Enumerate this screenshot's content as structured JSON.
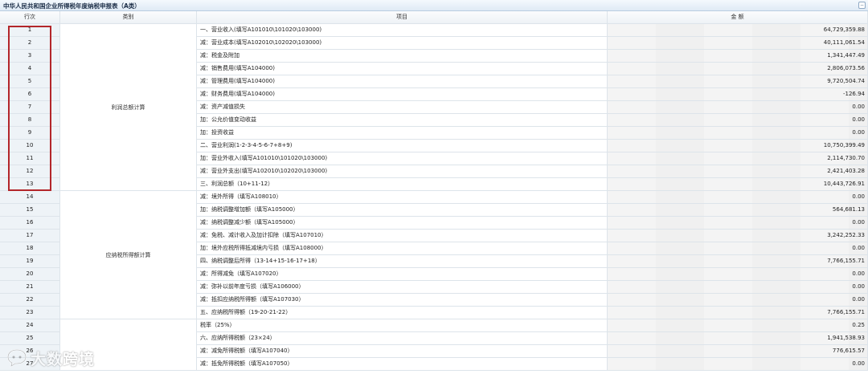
{
  "form": {
    "title": "中华人民共和国企业所得税年度纳税申报表（A类）",
    "collapse_glyph": "−"
  },
  "header": {
    "col_no": "行次",
    "col_category": "类别",
    "col_item": "项目",
    "col_amount": "金 额"
  },
  "categories": [
    {
      "label": "利润总额计算",
      "from": 1,
      "to": 13
    },
    {
      "label": "应纳税所得额计算",
      "from": 14,
      "to": 23
    },
    {
      "label": "",
      "from": 24,
      "to": 27
    }
  ],
  "rows": [
    {
      "no": "1",
      "item": "一、营业收入(填写A101010\\101020\\103000)",
      "amount": "64,729,359.88"
    },
    {
      "no": "2",
      "item": "减：营业成本(填写A102010\\102020\\103000)",
      "amount": "40,111,061.54"
    },
    {
      "no": "3",
      "item": "减：税金及附加",
      "amount": "1,341,447.49"
    },
    {
      "no": "4",
      "item": "减：销售费用(填写A104000)",
      "amount": "2,806,073.56"
    },
    {
      "no": "5",
      "item": "减：管理费用(填写A104000)",
      "amount": "9,720,504.74"
    },
    {
      "no": "6",
      "item": "减：财务费用(填写A104000)",
      "amount": "-126.94"
    },
    {
      "no": "7",
      "item": "减：资产减值损失",
      "amount": "0.00"
    },
    {
      "no": "8",
      "item": "加：公允价值变动收益",
      "amount": "0.00"
    },
    {
      "no": "9",
      "item": "加：投资收益",
      "amount": "0.00"
    },
    {
      "no": "10",
      "item": "二、营业利润(1-2-3-4-5-6-7+8+9)",
      "amount": "10,750,399.49"
    },
    {
      "no": "11",
      "item": "加：营业外收入(填写A101010\\101020\\103000)",
      "amount": "2,114,730.70"
    },
    {
      "no": "12",
      "item": "减：营业外支出(填写A102010\\102020\\103000)",
      "amount": "2,421,403.28"
    },
    {
      "no": "13",
      "item": "三、利润总额（10+11-12）",
      "amount": "10,443,726.91"
    },
    {
      "no": "14",
      "item": "减：境外所得（填写A108010）",
      "amount": "0.00"
    },
    {
      "no": "15",
      "item": "加：纳税调整增加额（填写A105000）",
      "amount": "564,681.13"
    },
    {
      "no": "16",
      "item": "减：纳税调整减少额（填写A105000）",
      "amount": "0.00"
    },
    {
      "no": "17",
      "item": "减：免税、减计收入及加计扣除（填写A107010）",
      "amount": "3,242,252.33"
    },
    {
      "no": "18",
      "item": "加：境外应税所得抵减境内亏损（填写A108000）",
      "amount": "0.00"
    },
    {
      "no": "19",
      "item": "四、纳税调整后所得（13-14+15-16-17+18）",
      "amount": "7,766,155.71"
    },
    {
      "no": "20",
      "item": "减：所得减免（填写A107020）",
      "amount": "0.00"
    },
    {
      "no": "21",
      "item": "减：弥补以前年度亏损（填写A106000）",
      "amount": "0.00"
    },
    {
      "no": "22",
      "item": "减：抵扣应纳税所得额（填写A107030）",
      "amount": "0.00"
    },
    {
      "no": "23",
      "item": "五、应纳税所得额（19-20-21-22）",
      "amount": "7,766,155.71"
    },
    {
      "no": "24",
      "item": "税率（25%）",
      "amount": "0.25"
    },
    {
      "no": "25",
      "item": "六、应纳所得税额（23×24）",
      "amount": "1,941,538.93"
    },
    {
      "no": "26",
      "item": "减：减免所得税额（填写A107040）",
      "amount": "776,615.57"
    },
    {
      "no": "27",
      "item": "减：抵免所得税额（填写A107050）",
      "amount": "0.00"
    }
  ],
  "watermark": {
    "text": "大数跨境",
    "icon": "chat-bubble-logo-icon"
  }
}
